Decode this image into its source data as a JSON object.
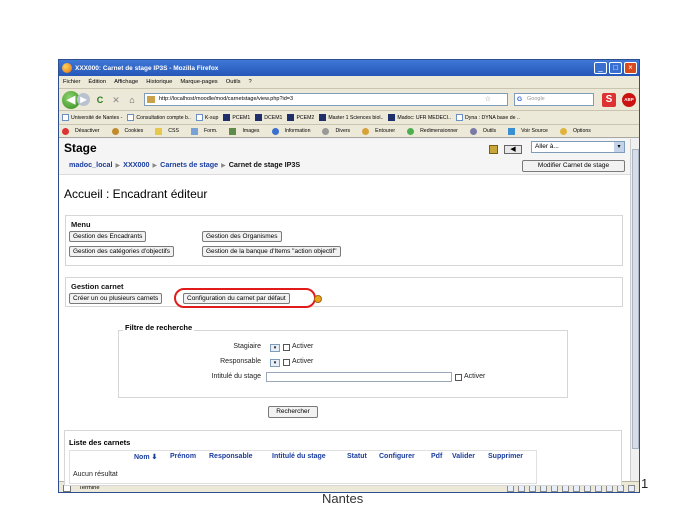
{
  "slide": {
    "number": "1",
    "footer": "Nantes"
  },
  "window": {
    "title": "XXX000: Carnet de stage IP3S - Mozilla Firefox",
    "minimize": "_",
    "maximize": "□",
    "close": "×"
  },
  "menubar": {
    "items": [
      "Fichier",
      "Édition",
      "Affichage",
      "Historique",
      "Marque-pages",
      "Outils",
      "?"
    ]
  },
  "navbar": {
    "back": "◀",
    "forward": "▶",
    "reload": "C",
    "stop": "✕",
    "home": "⌂",
    "url": "http://localhost/moodle/mod/carnetstage/view.php?id=3",
    "bookmark_star": "☆",
    "search_placeholder": "Google",
    "s_badge": "S",
    "abp_badge": "ABP"
  },
  "bookmarks": {
    "items": [
      "Université de Nantes -",
      "Consultation compte b..",
      "K-sup",
      "PCEM1",
      "DCEM1",
      "PCEM2",
      "Master 1 Sciences biol..",
      "Madoc: UFR MEDECI..",
      "Dyna : DYNA base de .."
    ]
  },
  "devbar": {
    "items": [
      "Désactiver",
      "Cookies",
      "CSS",
      "Form.",
      "Images",
      "Information",
      "Divers",
      "Entourer",
      "Redimensionner",
      "Outils",
      "Voir Source",
      "Options"
    ]
  },
  "header": {
    "title": "Stage",
    "jump_label": "Aller à...",
    "modify_button": "Modifier Carnet de stage",
    "breadcrumb": {
      "items": [
        "madoc_local",
        "XXX000",
        "Carnets de stage"
      ],
      "current": "Carnet de stage IP3S",
      "separator": "▶"
    }
  },
  "page": {
    "heading": "Accueil : Encadrant éditeur"
  },
  "menu_box": {
    "title": "Menu",
    "buttons": {
      "encadrants": "Gestion des Encadrants",
      "organismes": "Gestion des Organismes",
      "categories": "Gestion des catégories d'objectifs",
      "banque": "Gestion de la banque d'Items \"action objectif\""
    }
  },
  "carnet_box": {
    "title": "Gestion carnet",
    "buttons": {
      "create": "Créer un ou plusieurs carnets",
      "config": "Configuration du carnet par défaut"
    }
  },
  "filter": {
    "title": "Filtre de recherche",
    "stagiaire_label": "Stagiaire",
    "responsable_label": "Responsable",
    "intitule_label": "Intitulé du stage",
    "activer_label": "Activer",
    "select_arrow": "▾",
    "search_button": "Rechercher"
  },
  "list": {
    "title": "Liste des carnets",
    "columns": [
      "Nom ⬇",
      "Prénom",
      "Responsable",
      "Intitulé du stage",
      "Statut",
      "Configurer",
      "Pdf",
      "Valider",
      "Supprimer"
    ],
    "empty_text": "Aucun résultat"
  },
  "statusbar": {
    "text": "Terminé"
  },
  "colors": {
    "titlebar": "#2556b8",
    "link": "#1a3d9e",
    "highlight_ring": "#e11b1b"
  }
}
